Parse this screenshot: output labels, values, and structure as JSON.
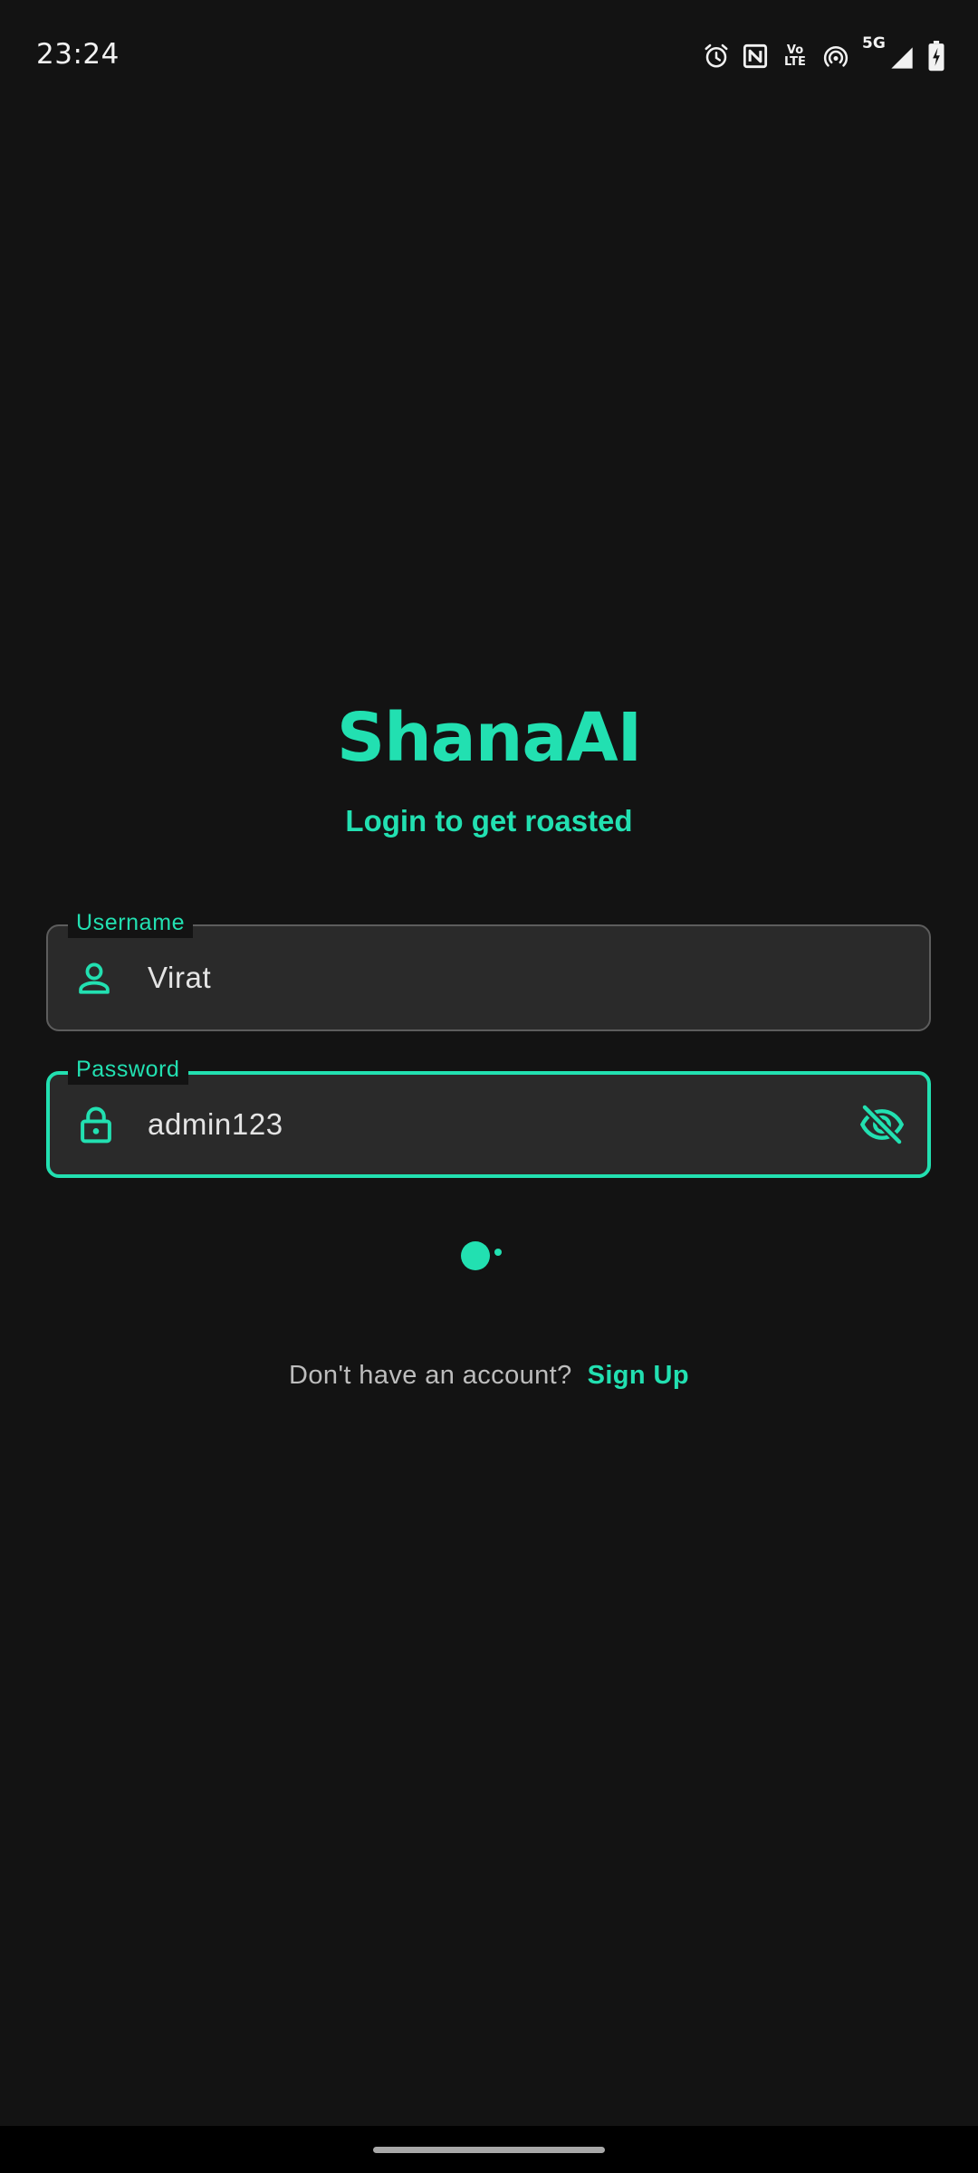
{
  "status_bar": {
    "time": "23:24",
    "icons": [
      "alarm-icon",
      "nfc-icon",
      "volte-icon",
      "hotspot-icon",
      "5g-icon",
      "signal-icon",
      "battery-charging-icon"
    ],
    "volte_top": "Vo",
    "volte_bottom": "LTE",
    "network_label": "5G"
  },
  "app": {
    "title": "ShanaAI",
    "subtitle": "Login to get roasted"
  },
  "form": {
    "username": {
      "label": "Username",
      "value": "Virat",
      "icon": "person-icon"
    },
    "password": {
      "label": "Password",
      "value": "admin123",
      "icon": "lock-icon",
      "toggle_icon": "visibility-off-icon"
    }
  },
  "signup": {
    "prompt": "Don't have an account?",
    "link": "Sign Up"
  },
  "colors": {
    "accent": "#22e0b1",
    "background": "#131313",
    "field_background": "#2a2a2a",
    "field_border": "#5d5d5d"
  }
}
